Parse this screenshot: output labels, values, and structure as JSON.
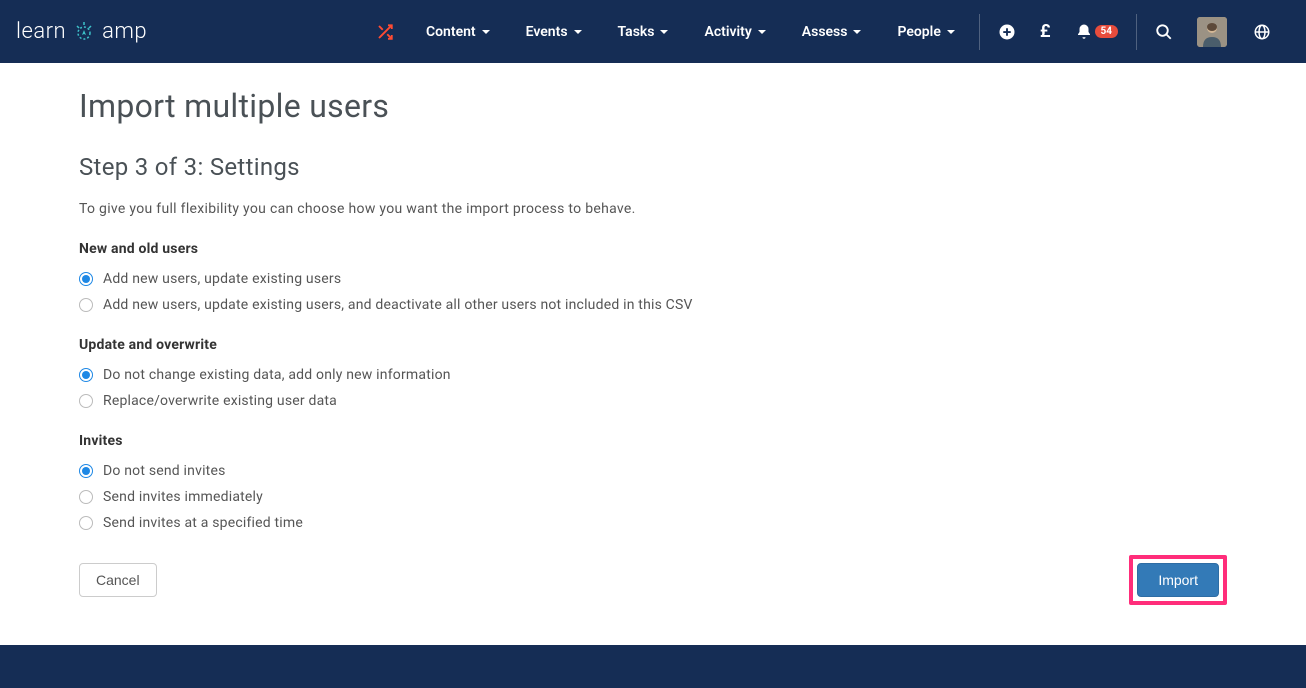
{
  "logo": {
    "text_left": "learn",
    "text_right": "amp"
  },
  "nav": {
    "items": [
      {
        "label": "Content"
      },
      {
        "label": "Events"
      },
      {
        "label": "Tasks"
      },
      {
        "label": "Activity"
      },
      {
        "label": "Assess"
      },
      {
        "label": "People"
      }
    ],
    "notification_count": "54",
    "currency_symbol": "£"
  },
  "page": {
    "title": "Import multiple users",
    "step_title": "Step 3 of 3: Settings",
    "description": "To give you full flexibility you can choose how you want the import process to behave."
  },
  "sections": {
    "new_old": {
      "label": "New and old users",
      "options": [
        {
          "label": "Add new users, update existing users",
          "selected": true
        },
        {
          "label": "Add new users, update existing users, and deactivate all other users not included in this CSV",
          "selected": false
        }
      ]
    },
    "update": {
      "label": "Update and overwrite",
      "options": [
        {
          "label": "Do not change existing data, add only new information",
          "selected": true
        },
        {
          "label": "Replace/overwrite existing user data",
          "selected": false
        }
      ]
    },
    "invites": {
      "label": "Invites",
      "options": [
        {
          "label": "Do not send invites",
          "selected": true
        },
        {
          "label": "Send invites immediately",
          "selected": false
        },
        {
          "label": "Send invites at a specified time",
          "selected": false
        }
      ]
    }
  },
  "actions": {
    "cancel": "Cancel",
    "import": "Import"
  }
}
